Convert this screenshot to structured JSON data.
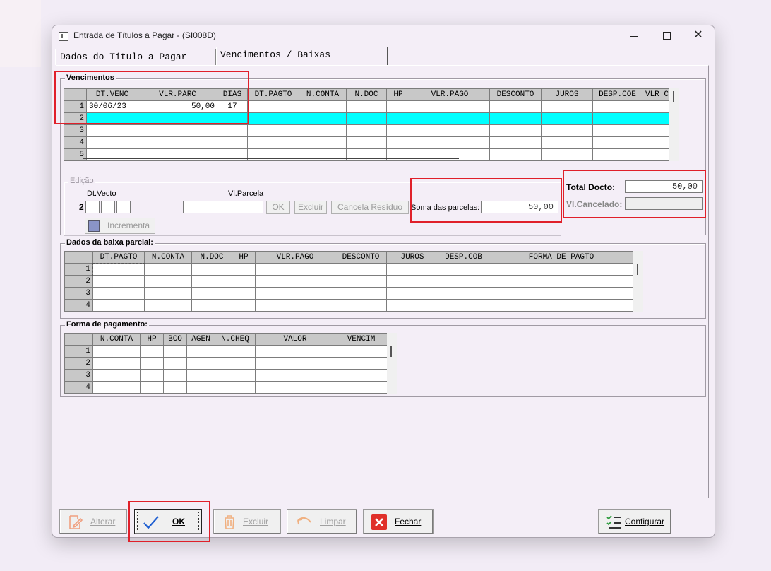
{
  "window": {
    "title": "Entrada de Títulos a Pagar - (SI008D)"
  },
  "window_controls": {
    "minimize": "",
    "maximize": "",
    "close": "✕"
  },
  "tabs": [
    {
      "label": "Dados do Título a Pagar",
      "active": false
    },
    {
      "label": "Vencimentos / Baixas",
      "active": true
    }
  ],
  "vencimentos": {
    "legend": "Vencimentos",
    "columns": [
      "DT.VENC",
      "VLR.PARC",
      "DIAS",
      "DT.PAGTO",
      "N.CONTA",
      "N.DOC",
      "HP",
      "VLR.PAGO",
      "DESCONTO",
      "JUROS",
      "DESP.COE",
      "VLR C"
    ],
    "rows": [
      {
        "n": "1",
        "cells": [
          "30/06/23",
          "50,00",
          "17",
          "",
          "",
          "",
          "",
          "",
          "",
          "",
          "",
          ""
        ]
      },
      {
        "n": "2",
        "cells": [
          "",
          "",
          "",
          "",
          "",
          "",
          "",
          "",
          "",
          "",
          "",
          ""
        ],
        "selected": true
      },
      {
        "n": "3",
        "cells": [
          "",
          "",
          "",
          "",
          "",
          "",
          "",
          "",
          "",
          "",
          "",
          ""
        ]
      },
      {
        "n": "4",
        "cells": [
          "",
          "",
          "",
          "",
          "",
          "",
          "",
          "",
          "",
          "",
          "",
          ""
        ]
      },
      {
        "n": "5",
        "cells": [
          "",
          "",
          "",
          "",
          "",
          "",
          "",
          "",
          "",
          "",
          "",
          ""
        ]
      }
    ]
  },
  "edicao": {
    "legend": "Edição",
    "dt_vecto_label": "Dt.Vecto",
    "row_number": "2",
    "vl_parcela_label": "Vl.Parcela",
    "vl_parcela_value": "",
    "ok_label": "OK",
    "excluir_label": "Excluir",
    "cancela_residuo_label": "Cancela Resíduo",
    "incrementa_label": "Incrementa",
    "soma_label": "Soma das parcelas:",
    "soma_value": "50,00"
  },
  "totals": {
    "total_docto_label": "Total Docto:",
    "total_docto_value": "50,00",
    "vl_cancelado_label": "Vl.Cancelado:",
    "vl_cancelado_value": ""
  },
  "baixa_parcial": {
    "legend": "Dados da baixa parcial:",
    "columns": [
      "DT.PAGTO",
      "N.CONTA",
      "N.DOC",
      "HP",
      "VLR.PAGO",
      "DESCONTO",
      "JUROS",
      "DESP.COB",
      "FORMA DE PAGTO"
    ],
    "rows": [
      {
        "n": "1",
        "cells": [
          "",
          "",
          "",
          "",
          "",
          "",
          "",
          "",
          ""
        ]
      },
      {
        "n": "2",
        "cells": [
          "",
          "",
          "",
          "",
          "",
          "",
          "",
          "",
          ""
        ]
      },
      {
        "n": "3",
        "cells": [
          "",
          "",
          "",
          "",
          "",
          "",
          "",
          "",
          ""
        ]
      },
      {
        "n": "4",
        "cells": [
          "",
          "",
          "",
          "",
          "",
          "",
          "",
          "",
          ""
        ]
      }
    ]
  },
  "forma_pagamento": {
    "legend": "Forma de pagamento:",
    "columns": [
      "N.CONTA",
      "HP",
      "BCO",
      "AGEN",
      "N.CHEQ",
      "VALOR",
      "VENCIM"
    ],
    "rows": [
      {
        "n": "1",
        "cells": [
          "",
          "",
          "",
          "",
          "",
          "",
          ""
        ]
      },
      {
        "n": "2",
        "cells": [
          "",
          "",
          "",
          "",
          "",
          "",
          ""
        ]
      },
      {
        "n": "3",
        "cells": [
          "",
          "",
          "",
          "",
          "",
          "",
          ""
        ]
      },
      {
        "n": "4",
        "cells": [
          "",
          "",
          "",
          "",
          "",
          "",
          ""
        ]
      }
    ]
  },
  "buttons": {
    "alterar": "Alterar",
    "ok": "OK",
    "excluir": "Excluir",
    "limpar": "Limpar",
    "fechar": "Fechar",
    "configurar": "Configurar"
  },
  "colors": {
    "selected_row": "#00ffff",
    "highlight": "#e0202a",
    "check_blue": "#1f5fd1",
    "close_red": "#e0302a"
  }
}
